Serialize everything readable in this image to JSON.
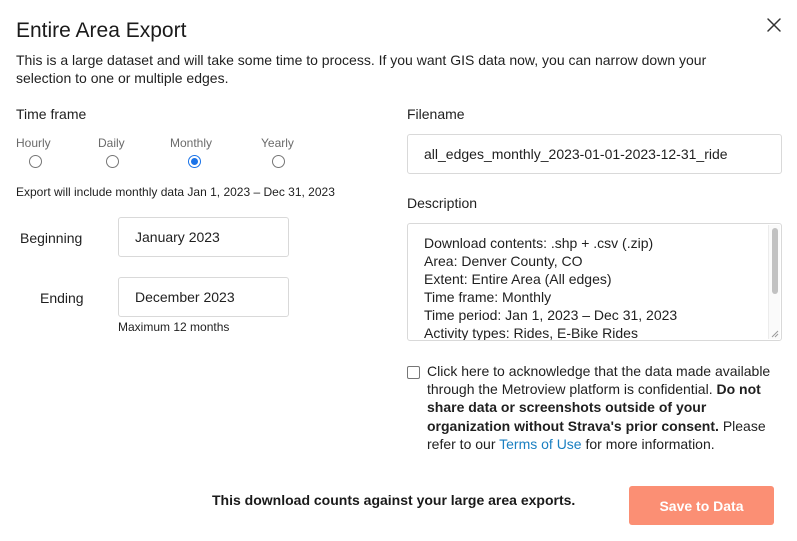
{
  "dialog": {
    "title": "Entire Area Export",
    "intro": "This is a large dataset and will take some time to process. If you want GIS data now, you can narrow down your selection to one or multiple edges."
  },
  "time_frame": {
    "label": "Time frame",
    "options": [
      {
        "label": "Hourly",
        "selected": false
      },
      {
        "label": "Daily",
        "selected": false
      },
      {
        "label": "Monthly",
        "selected": true
      },
      {
        "label": "Yearly",
        "selected": false
      }
    ],
    "summary": "Export will include monthly data Jan 1, 2023 – Dec 31, 2023"
  },
  "range": {
    "beginning_label": "Beginning",
    "beginning_value": "January 2023",
    "ending_label": "Ending",
    "ending_value": "December 2023",
    "max_hint": "Maximum 12 months"
  },
  "filename": {
    "label": "Filename",
    "value": "all_edges_monthly_2023-01-01-2023-12-31_ride"
  },
  "description": {
    "label": "Description",
    "lines": [
      "Download contents: .shp + .csv (.zip)",
      "Area: Denver County, CO",
      "Extent: Entire Area (All edges)",
      "Time frame: Monthly",
      "Time period: Jan 1, 2023 – Dec 31, 2023",
      "Activity types: Rides, E-Bike Rides"
    ]
  },
  "acknowledge": {
    "checked": false,
    "text_1": "Click here to acknowledge that the data made available through the Metroview platform is confidential.",
    "text_bold": "Do not share data or screenshots outside of your organization without Strava's prior consent.",
    "text_2": "Please refer to our",
    "link": "Terms of Use",
    "text_3": "for more information."
  },
  "footer": {
    "note": "This download counts against your large area exports.",
    "save_label": "Save to Data"
  },
  "colors": {
    "accent_radio": "#1a73e8",
    "link": "#1a7fc1",
    "save_button": "#fb8f74"
  }
}
